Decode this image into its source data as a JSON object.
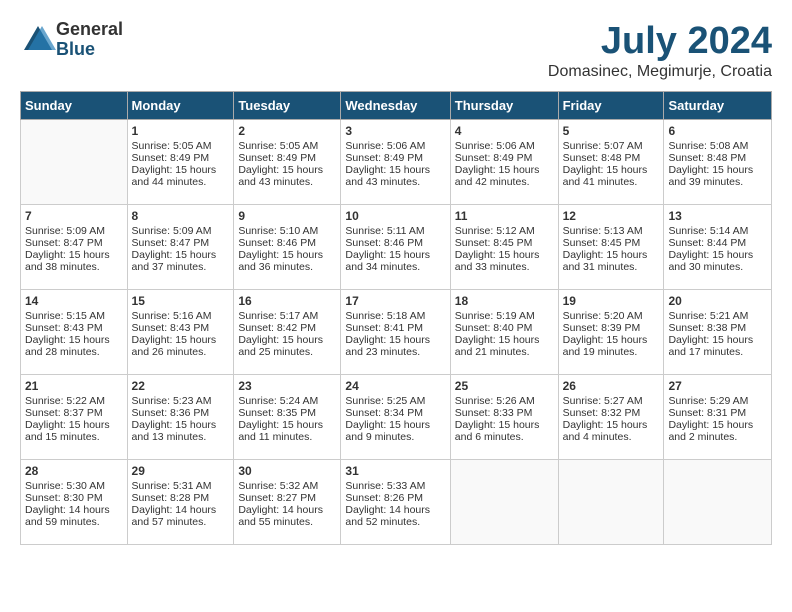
{
  "logo": {
    "general": "General",
    "blue": "Blue"
  },
  "header": {
    "month_year": "July 2024",
    "location": "Domasinec, Megimurje, Croatia"
  },
  "days_of_week": [
    "Sunday",
    "Monday",
    "Tuesday",
    "Wednesday",
    "Thursday",
    "Friday",
    "Saturday"
  ],
  "weeks": [
    [
      {
        "day": "",
        "sunrise": "",
        "sunset": "",
        "daylight": ""
      },
      {
        "day": "1",
        "sunrise": "Sunrise: 5:05 AM",
        "sunset": "Sunset: 8:49 PM",
        "daylight": "Daylight: 15 hours and 44 minutes."
      },
      {
        "day": "2",
        "sunrise": "Sunrise: 5:05 AM",
        "sunset": "Sunset: 8:49 PM",
        "daylight": "Daylight: 15 hours and 43 minutes."
      },
      {
        "day": "3",
        "sunrise": "Sunrise: 5:06 AM",
        "sunset": "Sunset: 8:49 PM",
        "daylight": "Daylight: 15 hours and 43 minutes."
      },
      {
        "day": "4",
        "sunrise": "Sunrise: 5:06 AM",
        "sunset": "Sunset: 8:49 PM",
        "daylight": "Daylight: 15 hours and 42 minutes."
      },
      {
        "day": "5",
        "sunrise": "Sunrise: 5:07 AM",
        "sunset": "Sunset: 8:48 PM",
        "daylight": "Daylight: 15 hours and 41 minutes."
      },
      {
        "day": "6",
        "sunrise": "Sunrise: 5:08 AM",
        "sunset": "Sunset: 8:48 PM",
        "daylight": "Daylight: 15 hours and 39 minutes."
      }
    ],
    [
      {
        "day": "7",
        "sunrise": "Sunrise: 5:09 AM",
        "sunset": "Sunset: 8:47 PM",
        "daylight": "Daylight: 15 hours and 38 minutes."
      },
      {
        "day": "8",
        "sunrise": "Sunrise: 5:09 AM",
        "sunset": "Sunset: 8:47 PM",
        "daylight": "Daylight: 15 hours and 37 minutes."
      },
      {
        "day": "9",
        "sunrise": "Sunrise: 5:10 AM",
        "sunset": "Sunset: 8:46 PM",
        "daylight": "Daylight: 15 hours and 36 minutes."
      },
      {
        "day": "10",
        "sunrise": "Sunrise: 5:11 AM",
        "sunset": "Sunset: 8:46 PM",
        "daylight": "Daylight: 15 hours and 34 minutes."
      },
      {
        "day": "11",
        "sunrise": "Sunrise: 5:12 AM",
        "sunset": "Sunset: 8:45 PM",
        "daylight": "Daylight: 15 hours and 33 minutes."
      },
      {
        "day": "12",
        "sunrise": "Sunrise: 5:13 AM",
        "sunset": "Sunset: 8:45 PM",
        "daylight": "Daylight: 15 hours and 31 minutes."
      },
      {
        "day": "13",
        "sunrise": "Sunrise: 5:14 AM",
        "sunset": "Sunset: 8:44 PM",
        "daylight": "Daylight: 15 hours and 30 minutes."
      }
    ],
    [
      {
        "day": "14",
        "sunrise": "Sunrise: 5:15 AM",
        "sunset": "Sunset: 8:43 PM",
        "daylight": "Daylight: 15 hours and 28 minutes."
      },
      {
        "day": "15",
        "sunrise": "Sunrise: 5:16 AM",
        "sunset": "Sunset: 8:43 PM",
        "daylight": "Daylight: 15 hours and 26 minutes."
      },
      {
        "day": "16",
        "sunrise": "Sunrise: 5:17 AM",
        "sunset": "Sunset: 8:42 PM",
        "daylight": "Daylight: 15 hours and 25 minutes."
      },
      {
        "day": "17",
        "sunrise": "Sunrise: 5:18 AM",
        "sunset": "Sunset: 8:41 PM",
        "daylight": "Daylight: 15 hours and 23 minutes."
      },
      {
        "day": "18",
        "sunrise": "Sunrise: 5:19 AM",
        "sunset": "Sunset: 8:40 PM",
        "daylight": "Daylight: 15 hours and 21 minutes."
      },
      {
        "day": "19",
        "sunrise": "Sunrise: 5:20 AM",
        "sunset": "Sunset: 8:39 PM",
        "daylight": "Daylight: 15 hours and 19 minutes."
      },
      {
        "day": "20",
        "sunrise": "Sunrise: 5:21 AM",
        "sunset": "Sunset: 8:38 PM",
        "daylight": "Daylight: 15 hours and 17 minutes."
      }
    ],
    [
      {
        "day": "21",
        "sunrise": "Sunrise: 5:22 AM",
        "sunset": "Sunset: 8:37 PM",
        "daylight": "Daylight: 15 hours and 15 minutes."
      },
      {
        "day": "22",
        "sunrise": "Sunrise: 5:23 AM",
        "sunset": "Sunset: 8:36 PM",
        "daylight": "Daylight: 15 hours and 13 minutes."
      },
      {
        "day": "23",
        "sunrise": "Sunrise: 5:24 AM",
        "sunset": "Sunset: 8:35 PM",
        "daylight": "Daylight: 15 hours and 11 minutes."
      },
      {
        "day": "24",
        "sunrise": "Sunrise: 5:25 AM",
        "sunset": "Sunset: 8:34 PM",
        "daylight": "Daylight: 15 hours and 9 minutes."
      },
      {
        "day": "25",
        "sunrise": "Sunrise: 5:26 AM",
        "sunset": "Sunset: 8:33 PM",
        "daylight": "Daylight: 15 hours and 6 minutes."
      },
      {
        "day": "26",
        "sunrise": "Sunrise: 5:27 AM",
        "sunset": "Sunset: 8:32 PM",
        "daylight": "Daylight: 15 hours and 4 minutes."
      },
      {
        "day": "27",
        "sunrise": "Sunrise: 5:29 AM",
        "sunset": "Sunset: 8:31 PM",
        "daylight": "Daylight: 15 hours and 2 minutes."
      }
    ],
    [
      {
        "day": "28",
        "sunrise": "Sunrise: 5:30 AM",
        "sunset": "Sunset: 8:30 PM",
        "daylight": "Daylight: 14 hours and 59 minutes."
      },
      {
        "day": "29",
        "sunrise": "Sunrise: 5:31 AM",
        "sunset": "Sunset: 8:28 PM",
        "daylight": "Daylight: 14 hours and 57 minutes."
      },
      {
        "day": "30",
        "sunrise": "Sunrise: 5:32 AM",
        "sunset": "Sunset: 8:27 PM",
        "daylight": "Daylight: 14 hours and 55 minutes."
      },
      {
        "day": "31",
        "sunrise": "Sunrise: 5:33 AM",
        "sunset": "Sunset: 8:26 PM",
        "daylight": "Daylight: 14 hours and 52 minutes."
      },
      {
        "day": "",
        "sunrise": "",
        "sunset": "",
        "daylight": ""
      },
      {
        "day": "",
        "sunrise": "",
        "sunset": "",
        "daylight": ""
      },
      {
        "day": "",
        "sunrise": "",
        "sunset": "",
        "daylight": ""
      }
    ]
  ]
}
